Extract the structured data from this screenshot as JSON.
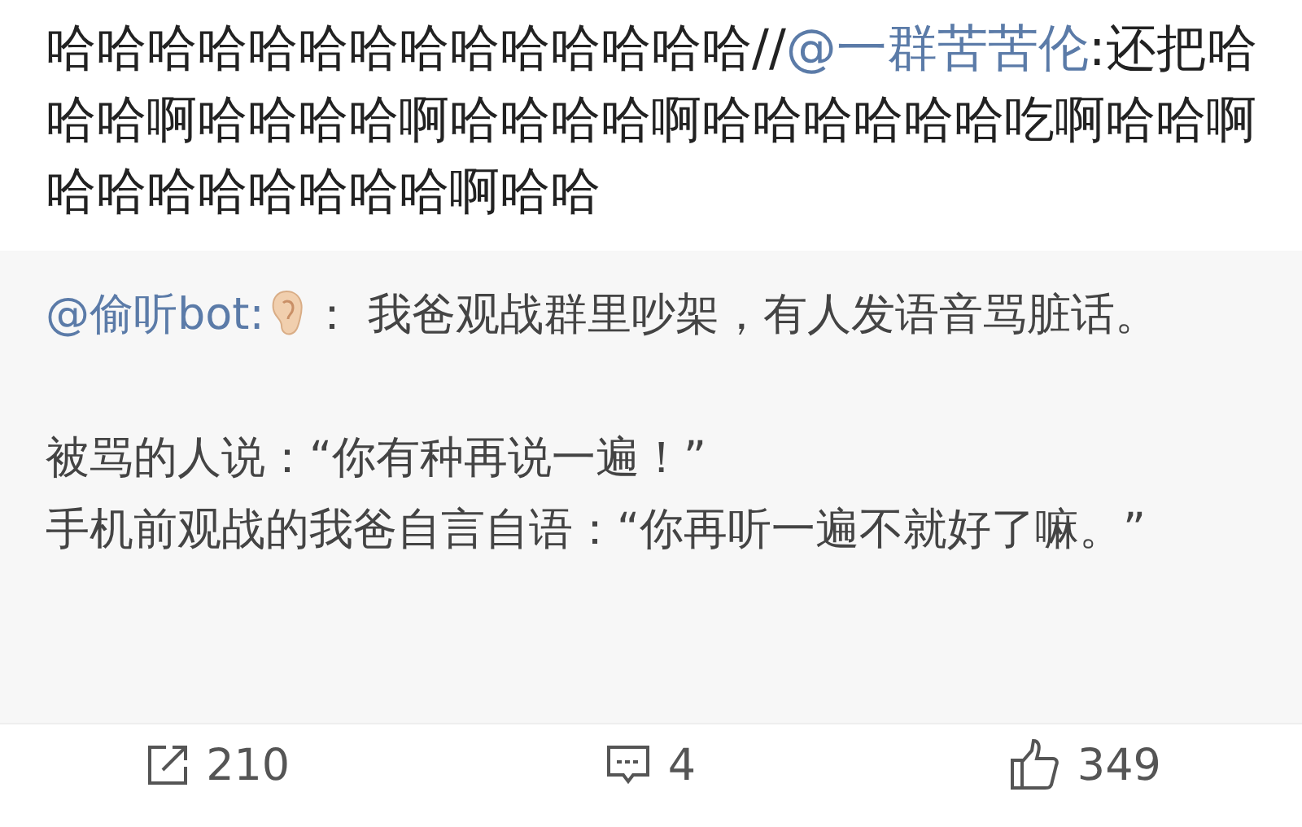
{
  "post": {
    "text": "哈哈哈哈哈哈哈哈哈哈哈哈哈哈//",
    "mention": "@一群苦苦伦",
    "text_after": ":还把哈哈哈啊哈哈哈哈啊哈哈哈哈啊哈哈哈哈哈哈吃啊哈哈啊哈哈哈哈哈哈哈哈啊哈哈"
  },
  "quoted": {
    "author": "@偷听bot:",
    "lead": "：  我爸观战群里吵架，有人发语音骂脏话。",
    "paragraphs": [
      "被骂的人说：“你有种再说一遍！”",
      "手机前观战的我爸自言自语：“你再听一遍不就好了嘛。”"
    ]
  },
  "actions": [
    {
      "kind": "repost",
      "count": "210"
    },
    {
      "kind": "comment",
      "count": "4"
    },
    {
      "kind": "like",
      "count": "349"
    }
  ]
}
